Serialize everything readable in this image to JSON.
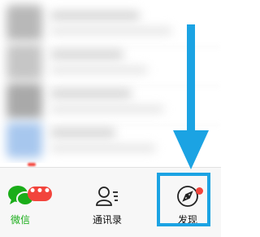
{
  "tabs": [
    {
      "id": "chats",
      "label": "微信",
      "icon": "chat-bubbles-icon",
      "active": true,
      "badge": "•••"
    },
    {
      "id": "contacts",
      "label": "通讯录",
      "icon": "contacts-icon",
      "active": false
    },
    {
      "id": "discover",
      "label": "发现",
      "icon": "compass-icon",
      "active": false,
      "dot": true
    }
  ],
  "colors": {
    "active_tab": "#1aad19",
    "badge": "#f2443c",
    "highlight": "#1ba3e3",
    "arrow": "#1ba3e3"
  },
  "annotation": {
    "icon": "down-arrow-icon",
    "target": "discover"
  }
}
